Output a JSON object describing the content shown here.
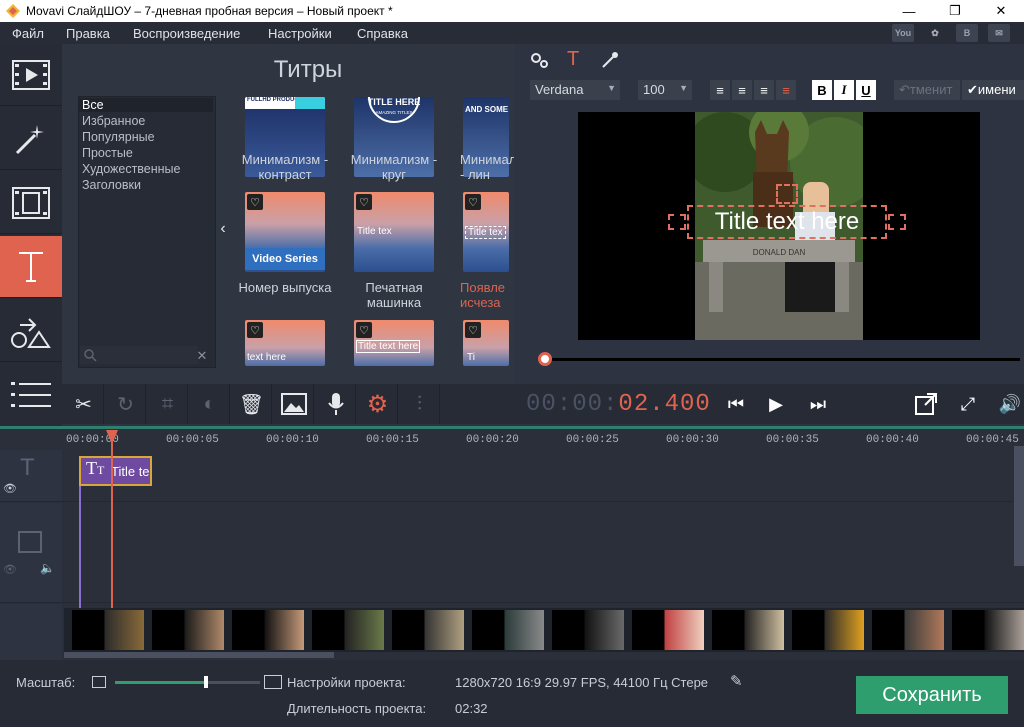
{
  "window": {
    "title": "Movavi СлайдШОУ – 7-дневная пробная версия – Новый проект *",
    "minimize": "—",
    "restore": "❐",
    "close": "✕"
  },
  "menu": [
    "Файл",
    "Правка",
    "Воспроизведение",
    "Настройки",
    "Справка"
  ],
  "social_icons": [
    "YouTube",
    "VK",
    "Одноклассники",
    "Chat"
  ],
  "left_tools": [
    "media-icon",
    "effects-icon",
    "transitions-icon",
    "titles-icon",
    "shapes-icon",
    "list-icon"
  ],
  "panel": {
    "title": "Титры",
    "categories": [
      "Все",
      "Избранное",
      "Популярные",
      "Простые",
      "Художественные",
      "Заголовки"
    ],
    "selected_category": 0,
    "titles": [
      {
        "label": "Минимализм - контраст",
        "thumb_text": "FULLHD PRODUCTION"
      },
      {
        "label": "Минимализм - круг",
        "thumb_text": "TITLE HERE"
      },
      {
        "label": "Минимализм - лин",
        "thumb_text": "AND SOME TI"
      },
      {
        "label": "Номер выпуска",
        "thumb_text": "Video Series"
      },
      {
        "label": "Печатная машинка",
        "thumb_text": "Title tex"
      },
      {
        "label": "Появле исчеза",
        "thumb_text": "Title tex"
      },
      {
        "label": "",
        "thumb_text": "text here"
      },
      {
        "label": "",
        "thumb_text": "Title text here"
      },
      {
        "label": "",
        "thumb_text": "Ti"
      }
    ],
    "thumb_sub": "AMAZING TITLES"
  },
  "preview_toolbar": {
    "font": "Verdana",
    "size": "100",
    "bold": "B",
    "italic": "I",
    "underline": "U",
    "undo_label": "тменит",
    "apply_label": "имени"
  },
  "preview": {
    "overlay_text": "Title text here",
    "bench_text": "DONALD DAN"
  },
  "timecode": {
    "dim": "00:00:",
    "active": "02.400"
  },
  "ruler": [
    "00:00:00",
    "00:00:05",
    "00:00:10",
    "00:00:15",
    "00:00:20",
    "00:00:25",
    "00:00:30",
    "00:00:35",
    "00:00:40",
    "00:00:45"
  ],
  "title_clip": {
    "text": "Title te"
  },
  "bottom": {
    "zoom_label": "Масштаб:",
    "settings_label": "Настройки проекта:",
    "settings_value": "1280x720 16:9 29.97 FPS, 44100 Гц Стере",
    "duration_label": "Длительность проекта:",
    "duration_value": "02:32",
    "save_label": "Сохранить",
    "zoom_level": 0.63
  },
  "colors": {
    "accent": "#e0634f",
    "save": "#2e9e6f",
    "clip": "#6e4aa0"
  }
}
